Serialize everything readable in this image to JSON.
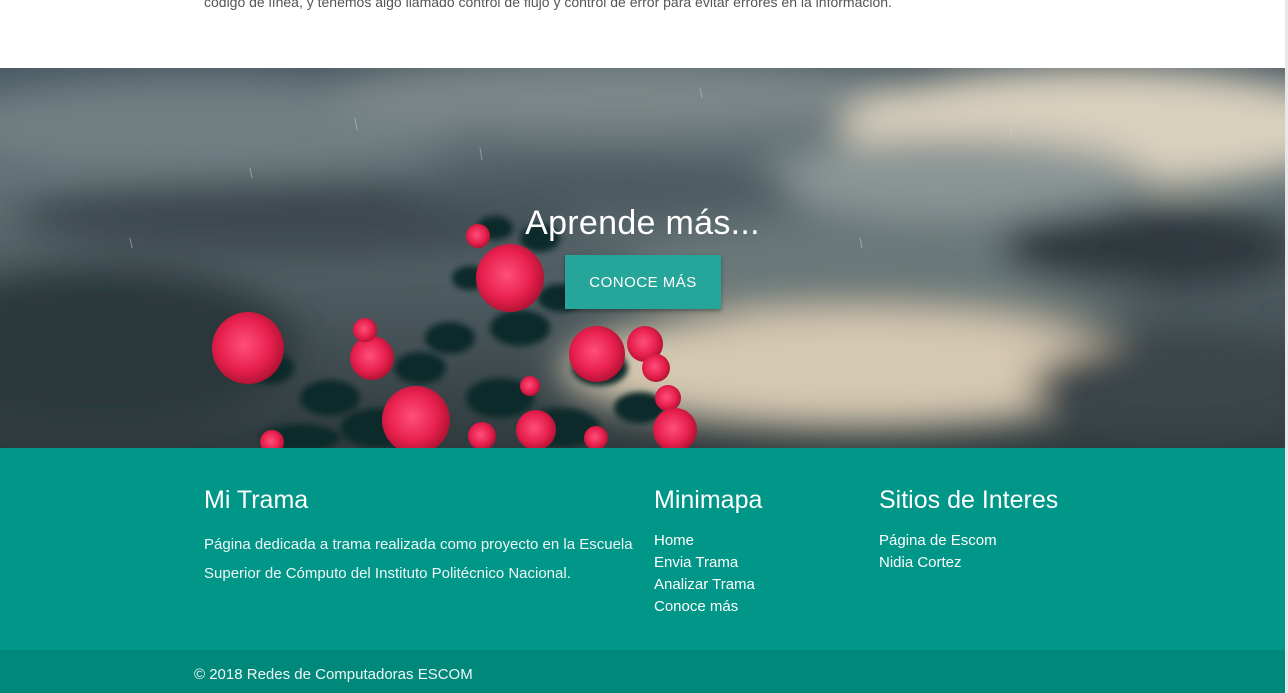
{
  "intro": {
    "text": "código de línea, y tenemos algo llamado control de flujo y control de error para evitar errores en la información."
  },
  "hero": {
    "title": "Aprende más...",
    "button_label": "CONOCE MÁS"
  },
  "footer": {
    "about": {
      "title": "Mi Trama",
      "description": "Página dedicada a trama realizada como proyecto en la Escuela Superior de Cómputo del Instituto Politécnico Nacional."
    },
    "minimap": {
      "title": "Minimapa",
      "links": [
        "Home",
        "Envia Trama",
        "Analizar Trama",
        "Conoce más"
      ]
    },
    "sites": {
      "title": "Sitios de Interes",
      "links": [
        "Página de Escom",
        "Nidia Cortez"
      ]
    },
    "copyright": "© 2018 Redes de Computadoras ESCOM"
  },
  "colors": {
    "footer_bg": "#009688",
    "copyright_bg": "#00897b",
    "button_bg": "#26a69a"
  }
}
